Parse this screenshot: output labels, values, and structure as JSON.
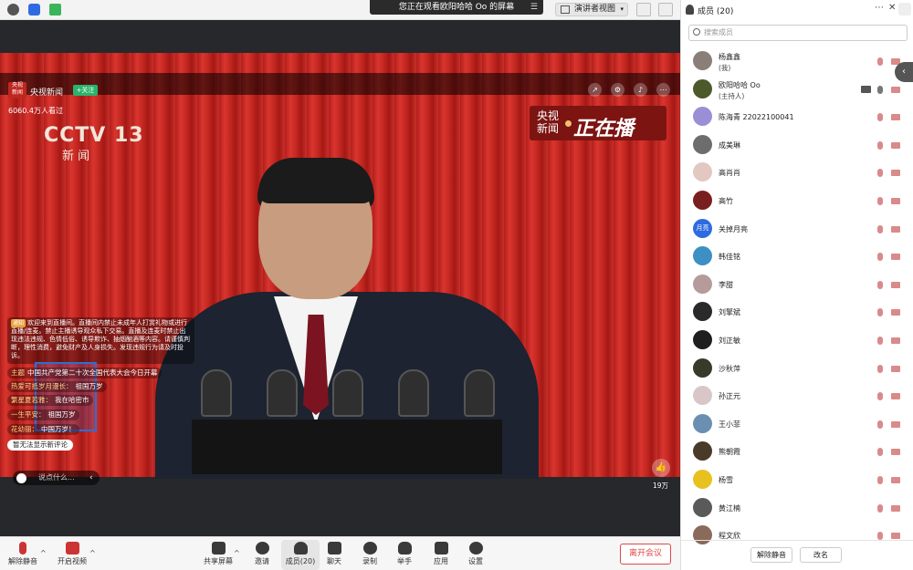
{
  "topbar": {
    "share_banner": "您正在观看欧阳哈哈 Oo 的屏幕",
    "view_mode": "演讲者视图"
  },
  "stream": {
    "channel_logo": "央视\n新闻",
    "channel_name": "央视新闻",
    "follow_label": "+关注",
    "viewers": "6060.4万人看过",
    "cctv_logo": "CCTV 13",
    "cctv_sub": "新 闻",
    "live_badge_a": "央视\n新闻",
    "live_badge_b": "正在播",
    "notice_tag": "通知",
    "notice_text": "欢迎来到直播间。直播间内禁止未成年人打赏礼物或进行直播/连麦。禁止主播诱导观众私下交易。直播及连麦时禁止出现违法违规、色情低俗、诱导欺诈、抽烟酗酒等内容。请谨慎判断，理性消费，避免财产及人身损失。发现违规行为请及时投诉。",
    "comments": [
      {
        "user": "主题",
        "text": "中国共产党第二十次全国代表大会今日开幕"
      },
      {
        "user": "热爱可抵岁月漫长：",
        "text": "祖国万岁"
      },
      {
        "user": "繁星夏若雅：",
        "text": "我在哈密市"
      },
      {
        "user": "一生平安：",
        "text": "祖国万岁"
      },
      {
        "user": "花幼丽：",
        "text": "中国万岁！"
      }
    ],
    "no_new_comments": "暂无法显示新评论",
    "comment_placeholder": "说点什么...",
    "like_count": "19万"
  },
  "toolbar": {
    "unmute": "解除静音",
    "start_video": "开启视频",
    "share_screen": "共享屏幕",
    "invite": "邀请",
    "members": "成员(20)",
    "chat": "聊天",
    "record": "录制",
    "raise_hand": "举手",
    "apps": "应用",
    "settings": "设置",
    "leave": "离开会议"
  },
  "panel": {
    "title": "成员 (20)",
    "search_placeholder": "搜索成员",
    "members": [
      {
        "name": "杨鑫鑫",
        "role": "(我)",
        "color": "#8a7f78"
      },
      {
        "name": "欧阳哈哈 Oo",
        "role": "(主持人)",
        "color": "#4c5a2a"
      },
      {
        "name": "陈海青 22022100041",
        "role": "",
        "color": "#9a8fd6"
      },
      {
        "name": "成美琳",
        "role": "",
        "color": "#6d6d6d"
      },
      {
        "name": "高肖肖",
        "role": "",
        "color": "#e2c8c0"
      },
      {
        "name": "高竹",
        "role": "",
        "color": "#7a1f1f"
      },
      {
        "name": "关掉月亮",
        "role": "",
        "avatar_text": "月亮",
        "color": "#2f6be0"
      },
      {
        "name": "韩佳铭",
        "role": "",
        "color": "#3e8fc4"
      },
      {
        "name": "李甜",
        "role": "",
        "color": "#b79a9a"
      },
      {
        "name": "刘擎斌",
        "role": "",
        "color": "#2a2a2a"
      },
      {
        "name": "刘正敏",
        "role": "",
        "color": "#1f1f1f"
      },
      {
        "name": "沙秋萍",
        "role": "",
        "color": "#3a3a2a"
      },
      {
        "name": "孙正元",
        "role": "",
        "color": "#d9c7c7"
      },
      {
        "name": "王小菲",
        "role": "",
        "color": "#6a8fb0"
      },
      {
        "name": "熊朝霞",
        "role": "",
        "color": "#4a3a2a"
      },
      {
        "name": "杨雪",
        "role": "",
        "color": "#e8c020"
      },
      {
        "name": "黄江楠",
        "role": "",
        "color": "#5a5a5a"
      },
      {
        "name": "程文欣",
        "role": "",
        "color": "#8a6a5a"
      }
    ],
    "unmute_all": "解除静音",
    "rename": "改名"
  }
}
